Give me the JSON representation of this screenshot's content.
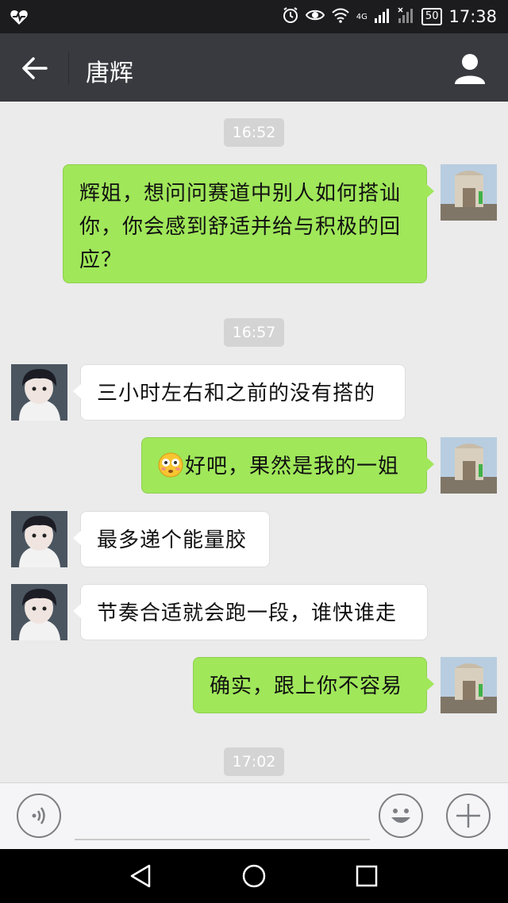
{
  "status_bar": {
    "left_icon": "heart-pulse-icon",
    "network_label": "4G",
    "battery": "50",
    "time": "17:38"
  },
  "header": {
    "title": "唐辉",
    "back_icon": "arrow-left-icon",
    "profile_icon": "person-icon"
  },
  "messages": [
    {
      "type": "timestamp",
      "text": "16:52"
    },
    {
      "type": "message",
      "sender": "me",
      "text": "辉姐，想问问赛道中别人如何搭讪你，你会感到舒适并给与积极的回应？"
    },
    {
      "type": "timestamp",
      "text": "16:57"
    },
    {
      "type": "message",
      "sender": "them",
      "text": "三小时左右和之前的没有搭的"
    },
    {
      "type": "message",
      "sender": "me",
      "emoji": "flushed-face-emoji",
      "text": "好吧，果然是我的一姐"
    },
    {
      "type": "message",
      "sender": "them",
      "text": "最多递个能量胶"
    },
    {
      "type": "message",
      "sender": "them",
      "text": "节奏合适就会跑一段，谁快谁走"
    },
    {
      "type": "message",
      "sender": "me",
      "text": "确实，跟上你不容易"
    },
    {
      "type": "timestamp",
      "text": "17:02"
    }
  ],
  "input_bar": {
    "voice_icon": "voice-icon",
    "input_value": "",
    "emoji_icon": "smiley-icon",
    "plus_icon": "plus-icon"
  },
  "nav_bar": {
    "back_icon": "triangle-back-icon",
    "home_icon": "circle-home-icon",
    "recents_icon": "square-recents-icon"
  },
  "colors": {
    "header_bg": "#393a3f",
    "status_bg": "#1c1c1f",
    "chat_bg": "#ebebeb",
    "my_bubble": "#a0e75a",
    "their_bubble": "#ffffff"
  }
}
